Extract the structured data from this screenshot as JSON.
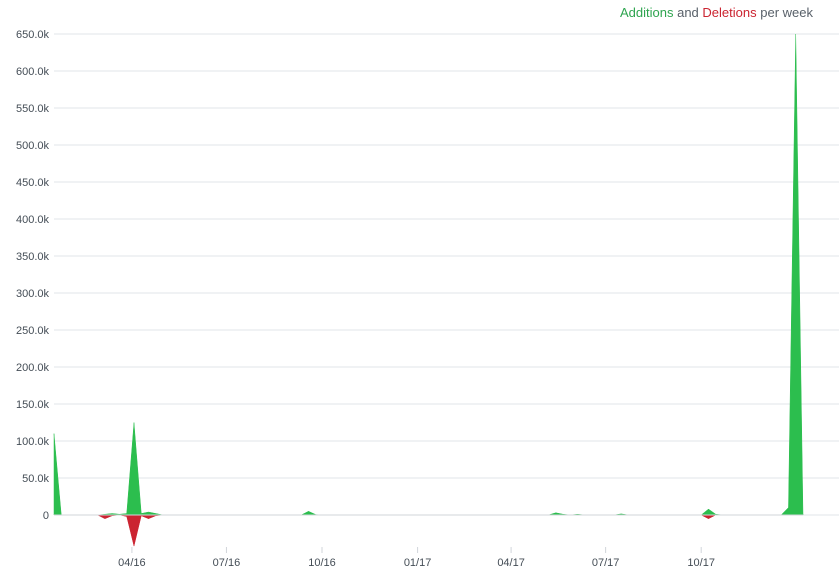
{
  "legend": {
    "additions_label": "Additions",
    "and_label": "and",
    "deletions_label": "Deletions",
    "suffix": "per week"
  },
  "colors": {
    "additions": "#2cbe4e",
    "deletions": "#cb2431",
    "grid": "#e1e4e8",
    "axis_text": "#444d56"
  },
  "chart_data": {
    "type": "area",
    "title": "Additions and Deletions per week",
    "x_type": "date",
    "x_range": [
      "2016-01-17",
      "2018-01-07"
    ],
    "y_range": [
      -50000,
      650000
    ],
    "y_ticks": [
      0,
      50000,
      100000,
      150000,
      200000,
      250000,
      300000,
      350000,
      400000,
      450000,
      500000,
      550000,
      600000,
      650000
    ],
    "y_tick_labels": [
      "0",
      "50.0k",
      "100.0k",
      "150.0k",
      "200.0k",
      "250.0k",
      "300.0k",
      "350.0k",
      "400.0k",
      "450.0k",
      "500.0k",
      "550.0k",
      "600.0k",
      "650.0k"
    ],
    "x_ticks": [
      "2016-04-01",
      "2016-07-01",
      "2016-10-01",
      "2017-01-01",
      "2017-04-01",
      "2017-07-01",
      "2017-10-01"
    ],
    "x_tick_labels": [
      "04/16",
      "07/16",
      "10/16",
      "01/17",
      "04/17",
      "07/17",
      "10/17"
    ],
    "grid": true,
    "legend_position": "top-right",
    "series": [
      {
        "name": "Additions",
        "points": [
          [
            "2016-01-17",
            110000
          ],
          [
            "2016-01-24",
            0
          ],
          [
            "2016-02-28",
            0
          ],
          [
            "2016-03-06",
            1000
          ],
          [
            "2016-03-13",
            2000
          ],
          [
            "2016-03-20",
            1000
          ],
          [
            "2016-03-27",
            2000
          ],
          [
            "2016-04-03",
            125000
          ],
          [
            "2016-04-10",
            2000
          ],
          [
            "2016-04-17",
            4000
          ],
          [
            "2016-04-24",
            2000
          ],
          [
            "2016-05-01",
            0
          ],
          [
            "2016-09-11",
            0
          ],
          [
            "2016-09-18",
            5000
          ],
          [
            "2016-09-25",
            500
          ],
          [
            "2016-10-02",
            0
          ],
          [
            "2017-04-02",
            0
          ],
          [
            "2017-05-07",
            0
          ],
          [
            "2017-05-14",
            3000
          ],
          [
            "2017-05-21",
            1000
          ],
          [
            "2017-05-28",
            0
          ],
          [
            "2017-06-04",
            1000
          ],
          [
            "2017-06-11",
            0
          ],
          [
            "2017-07-09",
            0
          ],
          [
            "2017-07-16",
            1500
          ],
          [
            "2017-07-23",
            0
          ],
          [
            "2017-10-01",
            0
          ],
          [
            "2017-10-08",
            8000
          ],
          [
            "2017-10-15",
            1000
          ],
          [
            "2017-10-22",
            0
          ],
          [
            "2017-12-17",
            0
          ],
          [
            "2017-12-24",
            10000
          ],
          [
            "2017-12-31",
            650000
          ],
          [
            "2018-01-07",
            0
          ]
        ]
      },
      {
        "name": "Deletions",
        "points": [
          [
            "2016-01-17",
            0
          ],
          [
            "2016-02-28",
            0
          ],
          [
            "2016-03-06",
            -5000
          ],
          [
            "2016-03-13",
            -1000
          ],
          [
            "2016-03-20",
            0
          ],
          [
            "2016-03-27",
            -2000
          ],
          [
            "2016-04-03",
            -42000
          ],
          [
            "2016-04-10",
            -1000
          ],
          [
            "2016-04-17",
            -5000
          ],
          [
            "2016-04-24",
            -1000
          ],
          [
            "2016-05-01",
            0
          ],
          [
            "2017-10-01",
            0
          ],
          [
            "2017-10-08",
            -5000
          ],
          [
            "2017-10-15",
            0
          ],
          [
            "2018-01-07",
            0
          ]
        ]
      }
    ]
  }
}
